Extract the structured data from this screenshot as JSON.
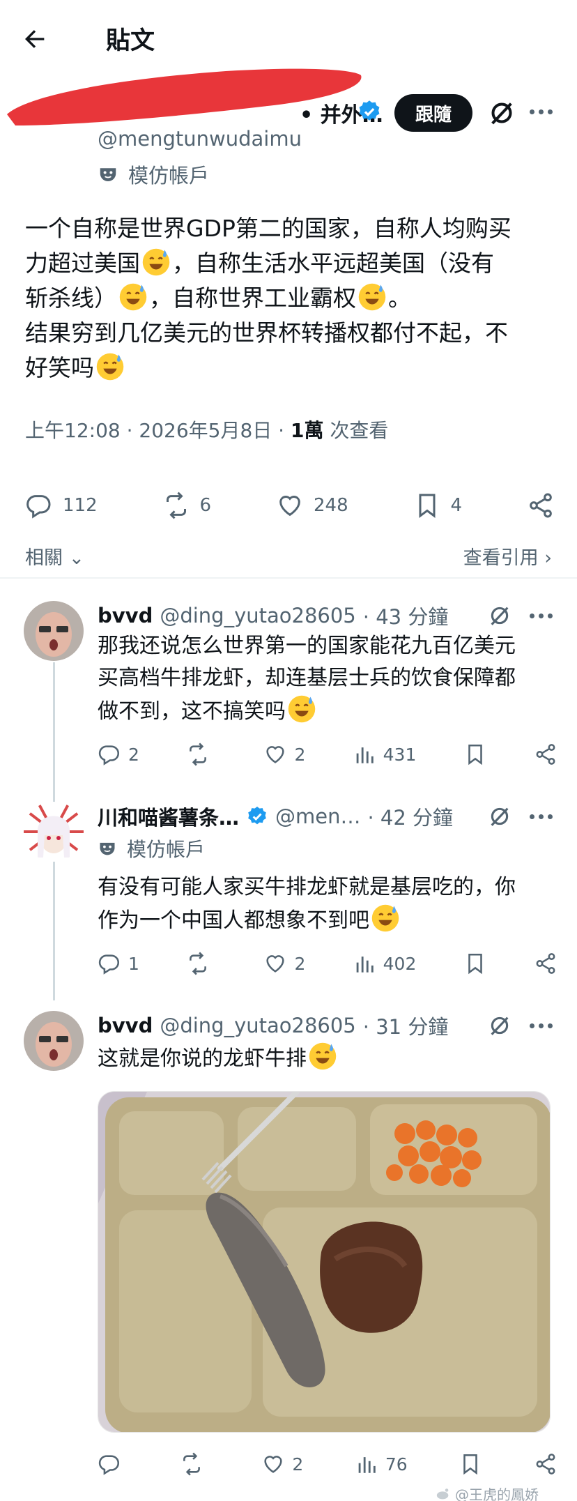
{
  "header": {
    "title": "貼文"
  },
  "author": {
    "name_visible": "• 并外…",
    "handle": "@mengtunwudaimu",
    "parody_label": "模仿帳戶",
    "follow_label": "跟隨"
  },
  "post": {
    "lines": [
      "一个自称是世界GDP第二的国家，自称人均购买",
      "力超过美国{e}，自称生活水平远超美国（没有",
      "斩杀线）{e}，自称世界工业霸权{e}。",
      "结果穷到几亿美元的世界杯转播权都付不起，不",
      "好笑吗{e}"
    ],
    "time": "上午12:08 · 2026年5月8日 ·",
    "views_count": "1萬",
    "views_label": "次查看",
    "stats": {
      "replies": "112",
      "reposts": "6",
      "likes": "248",
      "bookmarks": "4"
    },
    "related_label": "相關",
    "quotes_label": "查看引用"
  },
  "replies": [
    {
      "name": "bvvd",
      "handle": "@ding_yutao28605",
      "time": "· 43 分鐘",
      "lines": [
        "那我还说怎么世界第一的国家能花九百亿美元",
        "买高档牛排龙虾，却连基层士兵的饮食保障都",
        "做不到，这不搞笑吗{e}"
      ],
      "stats": {
        "replies": "2",
        "reposts": "",
        "likes": "2",
        "views": "431"
      }
    },
    {
      "name": "川和喵酱薯条…",
      "handle": "@men…",
      "time": "· 42 分鐘",
      "parody_label": "模仿帳戶",
      "lines": [
        "有没有可能人家买牛排龙虾就是基层吃的，你",
        "作为一个中国人都想象不到吧{e}"
      ],
      "stats": {
        "replies": "1",
        "reposts": "",
        "likes": "2",
        "views": "402"
      }
    },
    {
      "name": "bvvd",
      "handle": "@ding_yutao28605",
      "time": "· 31 分鐘",
      "lines": [
        "这就是你说的龙虾牛排{e}"
      ],
      "stats": {
        "replies": "",
        "reposts": "",
        "likes": "2",
        "views": "76"
      }
    }
  ],
  "watermark": "@王虎的鳳娇",
  "colors": {
    "text": "#0f1419",
    "muted": "#536471",
    "verified": "#1d9bf0",
    "redaction": "#e8363a"
  }
}
